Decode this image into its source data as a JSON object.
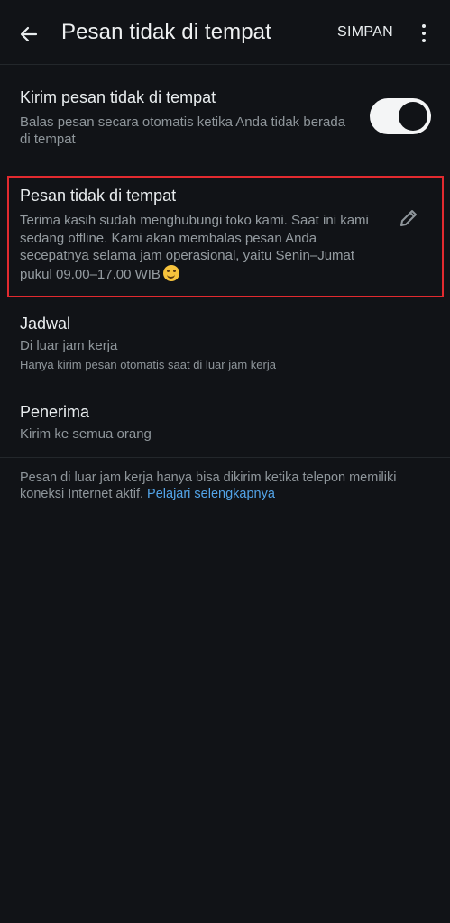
{
  "header": {
    "title": "Pesan tidak di tempat",
    "save_label": "SIMPAN",
    "back_icon": "arrow-left-icon",
    "more_icon": "more-vertical-icon"
  },
  "send_away": {
    "title": "Kirim pesan tidak di tempat",
    "description": "Balas pesan secara otomatis ketika Anda tidak berada di tempat",
    "enabled": true
  },
  "away_message": {
    "title": "Pesan tidak di tempat",
    "message": "Terima kasih sudah menghubungi toko kami. Saat ini kami sedang offline. Kami akan membalas pesan Anda secepatnya selama jam operasional, yaitu Senin–Jumat pukul 09.00–17.00 WIB",
    "emoji": "smiling-face-icon",
    "edit_icon": "pencil-icon"
  },
  "schedule": {
    "title": "Jadwal",
    "value": "Di luar jam kerja",
    "note": "Hanya kirim pesan otomatis saat di luar jam kerja"
  },
  "recipient": {
    "title": "Penerima",
    "value": "Kirim ke semua orang"
  },
  "footer": {
    "note": "Pesan di luar jam kerja hanya bisa dikirim ketika telepon memiliki koneksi Internet aktif.",
    "link_label": "Pelajari selengkapnya"
  },
  "colors": {
    "background": "#111317",
    "highlight_border": "#e22a2f",
    "link": "#53a4e8"
  }
}
